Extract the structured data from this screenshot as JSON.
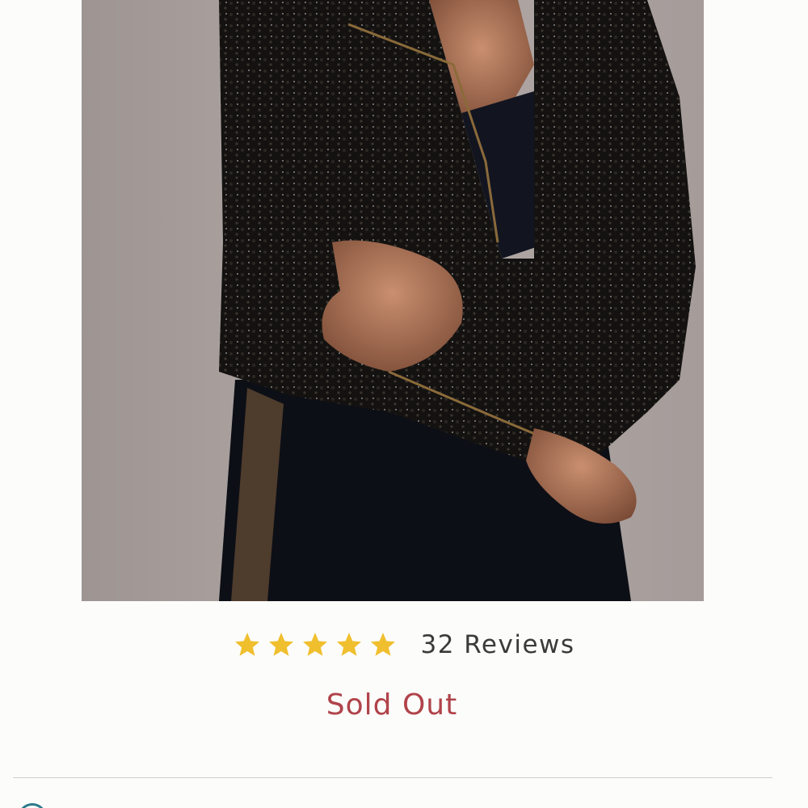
{
  "product": {
    "image_alt": "Model wearing black sequin cropped moto jacket over black satin slip dress",
    "rating": {
      "stars": 5,
      "max_stars": 5,
      "star_color": "#f0bf2e",
      "reviews_label": "32 Reviews"
    },
    "status": {
      "label": "Sold Out",
      "color": "#b0434a"
    }
  },
  "icons": {
    "bottom_left": "info-icon"
  }
}
